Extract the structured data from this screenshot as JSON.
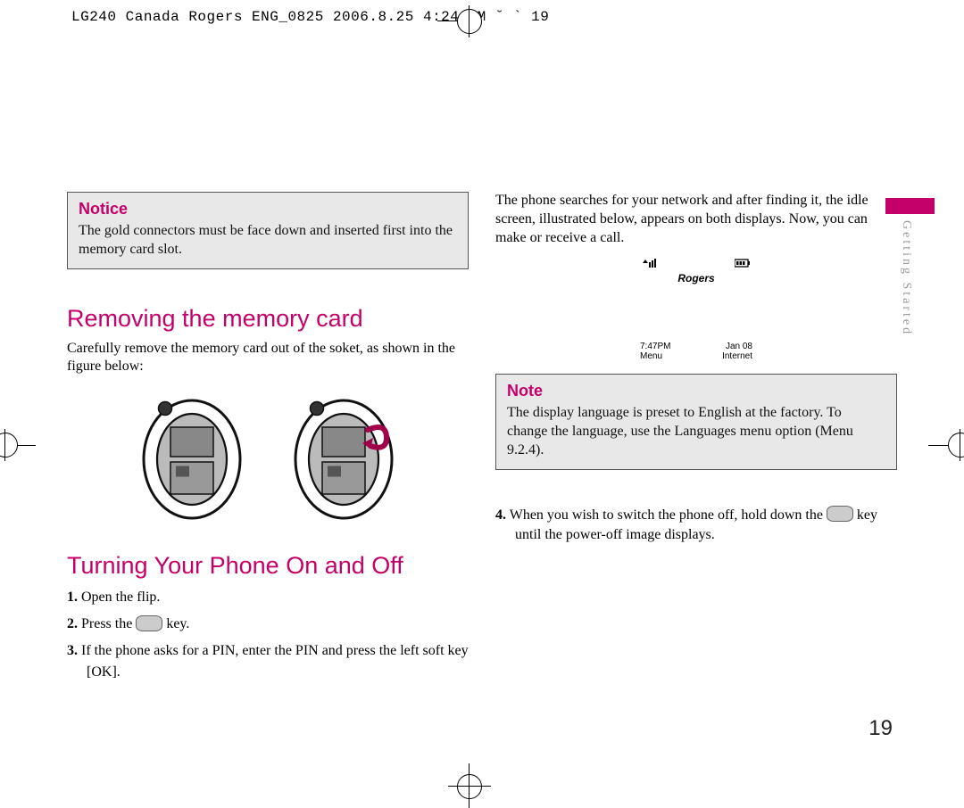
{
  "header_meta": "LG240 Canada Rogers ENG_0825  2006.8.25 4:24 PM  ˘   ` 19",
  "notice": {
    "title": "Notice",
    "body": "The gold connectors must be face down and inserted first into the memory card slot."
  },
  "section1": {
    "heading": "Removing the memory card",
    "body": "Carefully remove the memory card out of the soket, as shown in the figure below:"
  },
  "section2": {
    "heading": "Turning Your Phone On and Off",
    "steps": {
      "s1": "Open the flip.",
      "s2a": "Press the ",
      "s2b": " key.",
      "s3": "If the phone asks for a PIN, enter the PIN and press the left soft key [OK]."
    }
  },
  "right_intro": "The phone searches for your network and after finding it, the idle screen, illustrated below, appears on both displays. Now, you can make or receive a call.",
  "screen": {
    "signal": "▼▮▮▮",
    "battery": "▮▮▮▮",
    "carrier": "Rogers",
    "time": "7:47PM",
    "date": "Jan 08",
    "softLeft": "Menu",
    "softRight": "Internet"
  },
  "note": {
    "title": "Note",
    "body": "The display language is preset to English at the factory. To change the language, use the Languages menu option (Menu 9.2.4)."
  },
  "step4": {
    "num": "4.",
    "a": " When you wish to switch the phone off, hold down the ",
    "b": " key until the power-off image displays."
  },
  "side_label": "Getting Started",
  "page_number": "19"
}
